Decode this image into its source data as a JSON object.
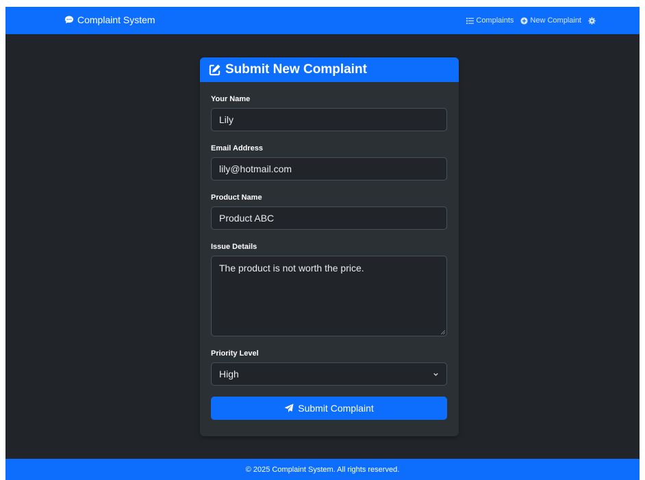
{
  "navbar": {
    "brand": "Complaint System",
    "links": [
      {
        "label": "Complaints",
        "icon": "list-icon"
      },
      {
        "label": "New Complaint",
        "icon": "plus-circle-icon"
      }
    ],
    "settings_icon": "gear-icon"
  },
  "form": {
    "title": "Submit New Complaint",
    "fields": {
      "name": {
        "label": "Your Name",
        "value": "Lily"
      },
      "email": {
        "label": "Email Address",
        "value": "lily@hotmail.com"
      },
      "product": {
        "label": "Product Name",
        "value": "Product ABC"
      },
      "issue": {
        "label": "Issue Details",
        "value": "The product is not worth the price."
      },
      "priority": {
        "label": "Priority Level",
        "value": "High"
      }
    },
    "submit_label": "Submit Complaint"
  },
  "footer": {
    "text": "© 2025 Complaint System. All rights reserved."
  },
  "colors": {
    "primary": "#0d6efd",
    "background": "#212529",
    "card": "#2b3035",
    "input_border": "#495057"
  }
}
